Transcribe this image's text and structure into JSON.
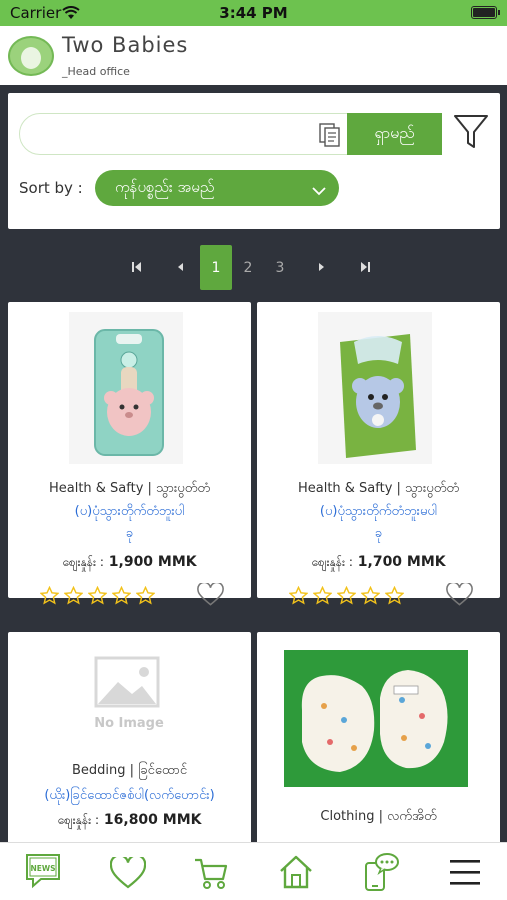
{
  "status": {
    "carrier": "Carrier",
    "time": "3:44 PM"
  },
  "header": {
    "title": "Two Babies",
    "subtitle": "_Head office"
  },
  "search": {
    "placeholder": "",
    "value": "",
    "button_label": "ရှာမည်"
  },
  "sort": {
    "label": "Sort by :",
    "selected": "ကုန်ပစ္စည်း အမည်"
  },
  "pagination": {
    "pages": [
      "1",
      "2",
      "3"
    ],
    "current": "1"
  },
  "products": [
    {
      "category": "Health & Safty | သွားပွတ်တံ",
      "name_line1": "(ပ)ပုံသွားတိုက်တံဘူးပါ",
      "name_line2": "ခု",
      "price_label": "စျေးနှုန်း :",
      "price": "1,900 MMK",
      "rating": 0
    },
    {
      "category": "Health & Safty | သွားပွတ်တံ",
      "name_line1": "(ပ)ပုံသွားတိုက်တံဘူးမပါ",
      "name_line2": "ခု",
      "price_label": "စျေးနှုန်း :",
      "price": "1,700 MMK",
      "rating": 0
    },
    {
      "category": "Bedding | ခြင်ထောင်",
      "name_line1": "(ယိုး)ခြင်ထောင်ဇစ်ပါ(လက်ဟောင်း)",
      "price_label": "စျေးနှုန်း :",
      "price": "16,800 MMK",
      "image_placeholder": "No Image"
    },
    {
      "category": "Clothing | လက်အိတ်"
    }
  ],
  "bottom_nav": {
    "news_label": "NEWS"
  },
  "colors": {
    "brand_green": "#5fa83e",
    "status_green": "#6dc24f",
    "link_blue": "#2a6cd6",
    "star_yellow": "#f2c21b"
  }
}
